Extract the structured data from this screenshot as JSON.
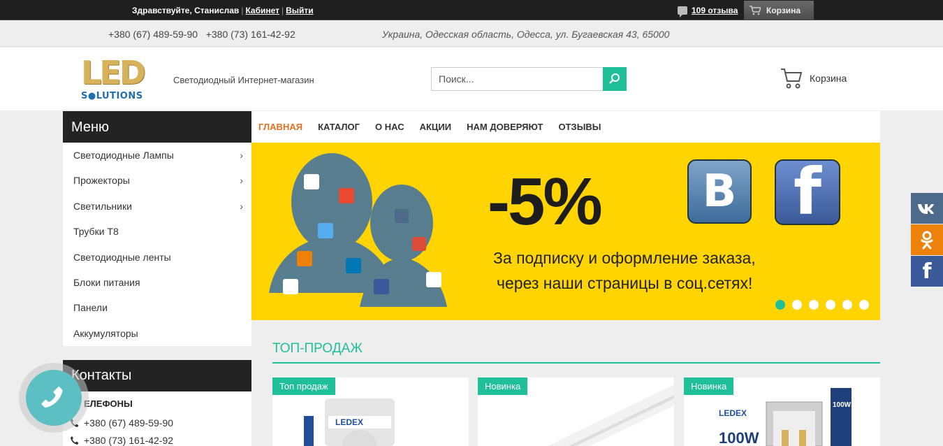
{
  "topbar": {
    "greeting": "Здравствуйте, Станислав",
    "cabinet": "Кабинет",
    "logout": "Выйти",
    "reviews": "109 отзыва",
    "cart": "Корзина"
  },
  "infobar": {
    "phones": "+380 (67) 489-59-90   +380 (73) 161-42-92",
    "address": "Украина, Одесская область, Одесса, ул. Бугаевская 43, 65000"
  },
  "header": {
    "tagline": "Светодиодный Интернет-магазин",
    "search_placeholder": "Поиск...",
    "cart": "Корзина"
  },
  "menu": {
    "title": "Меню",
    "items": [
      {
        "label": "Светодиодные Лампы",
        "chevron": "›"
      },
      {
        "label": "Прожекторы",
        "chevron": "›"
      },
      {
        "label": "Светильники",
        "chevron": "›"
      },
      {
        "label": "Трубки Т8",
        "chevron": ""
      },
      {
        "label": "Светодиодные ленты",
        "chevron": ""
      },
      {
        "label": "Блоки питания",
        "chevron": ""
      },
      {
        "label": "Панели",
        "chevron": ""
      },
      {
        "label": "Аккумуляторы",
        "chevron": ""
      }
    ]
  },
  "contacts": {
    "title": "Контакты",
    "label": "ЕЛЕФОНЫ",
    "phone1": "+380 (67) 489-59-90",
    "phone2": "+380 (73) 161-42-92"
  },
  "nav": {
    "items": [
      "ГЛАВНАЯ",
      "КАТАЛОГ",
      "О НАС",
      "АКЦИИ",
      "НАМ ДОВЕРЯЮТ",
      "ОТЗЫВЫ"
    ]
  },
  "banner": {
    "percent": "-5%",
    "line1": "За подписку и оформление заказа,",
    "line2": "через наши страницы в соц.сетях!",
    "vk": "B",
    "fb": "f",
    "active_slide": 1,
    "slides": 6
  },
  "top_sales": {
    "title": "ТОП-ПРОДАЖ",
    "cards": [
      {
        "badge": "Топ продаж",
        "brand": "LEDEX"
      },
      {
        "badge": "Новинка",
        "brand": ""
      },
      {
        "badge": "Новинка",
        "brand": "LEDEX",
        "power": "100W"
      }
    ]
  },
  "social": [
    {
      "name": "vk",
      "glyph": "vk",
      "color": "#4d6a8a"
    },
    {
      "name": "ok",
      "glyph": "ok",
      "color": "#ee8208"
    },
    {
      "name": "fb",
      "glyph": "f",
      "color": "#3b5998"
    }
  ],
  "colors": {
    "accent": "#1fbf9a",
    "active_nav": "#e0701d",
    "banner": "#ffd400"
  }
}
